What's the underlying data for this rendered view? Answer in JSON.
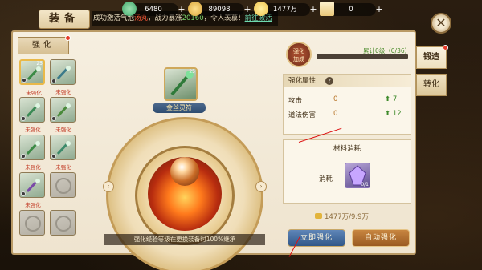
{
  "header": {
    "title": "装备",
    "ticker": {
      "text_a": "成功激活",
      "text_b": "气泡",
      "red_word": "汤丸",
      "text_c": "，战力暴涨",
      "green_num": "20160",
      "text_d": "，令人羡慕！",
      "link": "前往激活"
    },
    "currencies": [
      {
        "name": "jade-icon",
        "value": "6480",
        "color": "#3fa86a"
      },
      {
        "name": "ingot-icon",
        "value": "89098",
        "color": "#d9a43a"
      },
      {
        "name": "coin-icon",
        "value": "1477万",
        "color": "#f0c24a"
      },
      {
        "name": "scroll-icon",
        "value": "0",
        "color": "#e9c77a"
      }
    ]
  },
  "left": {
    "tab_label": "强化",
    "slots": [
      {
        "level": "25",
        "status": "未强化",
        "tint": "#3b8a45",
        "selected": true
      },
      {
        "level": "",
        "status": "未强化",
        "tint": "#3b7a8a",
        "selected": false
      },
      {
        "level": "",
        "status": "未强化",
        "tint": "#3b8a55",
        "selected": false
      },
      {
        "level": "",
        "status": "未强化",
        "tint": "#4a8a3b",
        "selected": false
      },
      {
        "level": "",
        "status": "未强化",
        "tint": "#3b8a45",
        "selected": false
      },
      {
        "level": "",
        "status": "未强化",
        "tint": "#3b8a6a",
        "selected": false
      },
      {
        "level": "",
        "status": "未强化",
        "tint": "#7a4aa8",
        "selected": false
      },
      {
        "level": "",
        "status": "",
        "tint": "",
        "selected": false
      },
      {
        "level": "",
        "status": "",
        "tint": "",
        "selected": false
      },
      {
        "level": "",
        "status": "",
        "tint": "",
        "selected": false
      }
    ]
  },
  "center": {
    "item_level": "25",
    "item_name": "金丝灵符",
    "inherit_note": "强化经验等级在更换装备时100%继承"
  },
  "right": {
    "badge_line1": "强化",
    "badge_line2": "加成",
    "cumulative": "累计0级（0/36）",
    "attr_title": "强化属性",
    "attributes": [
      {
        "name": "攻击",
        "value": "0",
        "gain": "7"
      },
      {
        "name": "道法伤害",
        "value": "0",
        "gain": "12"
      }
    ],
    "material_title": "材料消耗",
    "consume_label": "消耗",
    "material_qty": "0/1",
    "gold_need": "1477万/9.9万",
    "btn_instant": "立即强化",
    "btn_auto": "自动强化"
  },
  "tabs": [
    {
      "label": "锻造",
      "active": true
    },
    {
      "label": "转化",
      "active": false
    }
  ]
}
